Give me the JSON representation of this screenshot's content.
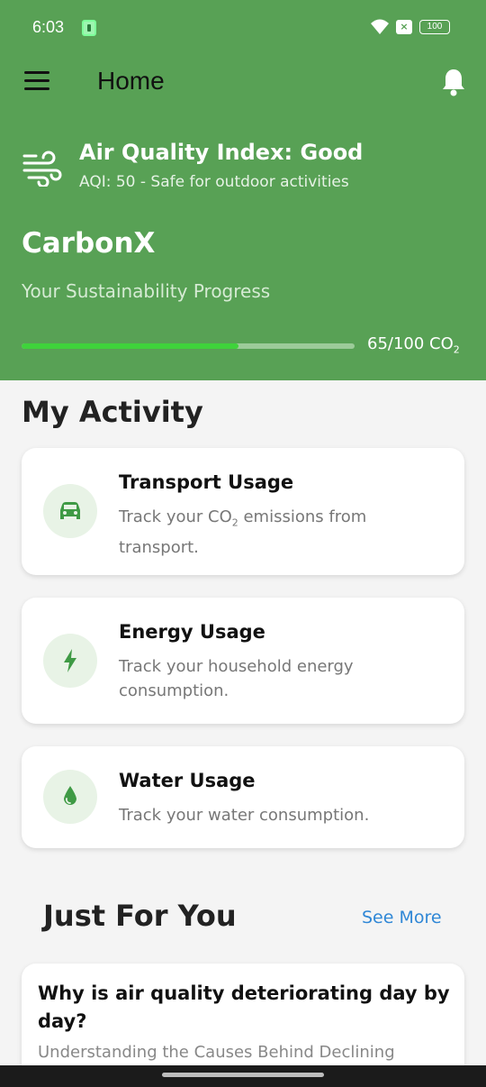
{
  "status_bar": {
    "time": "6:03",
    "battery": "100"
  },
  "toolbar": {
    "title": "Home"
  },
  "aqi": {
    "title": "Air Quality Index: Good",
    "subtitle": "AQI: 50 - Safe for outdoor activities"
  },
  "brand": "CarbonX",
  "progress": {
    "label": "Your Sustainability Progress",
    "value": "65/100 CO",
    "value_sub": "2",
    "fraction": 0.65
  },
  "activity": {
    "title": "My Activity",
    "cards": [
      {
        "title": "Transport Usage",
        "desc_pre": "Track your CO",
        "desc_sub": "2",
        "desc_post": " emissions from transport.",
        "icon": "car-icon"
      },
      {
        "title": "Energy Usage",
        "desc": "Track your household energy consumption.",
        "icon": "lightning-icon"
      },
      {
        "title": "Water Usage",
        "desc": "Track your water consumption.",
        "icon": "water-drop-icon"
      }
    ]
  },
  "just_for_you": {
    "title": "Just For You",
    "see_more": "See More",
    "article": {
      "title": "Why is air quality deteriorating day by day?",
      "subtitle": "Understanding the Causes Behind Declining"
    }
  },
  "colors": {
    "header": "#58a155",
    "accent": "#3fd33b",
    "link": "#2f87d6",
    "icon": "#3f9a45"
  }
}
